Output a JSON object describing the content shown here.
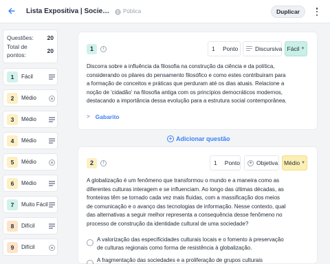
{
  "header": {
    "back_icon": "arrow-left-icon",
    "title": "Lista Expositiva | Sociedade e Política",
    "visibility": "Pública",
    "visibility_icon": "globe-icon",
    "duplicate_label": "Duplicar",
    "more_icon": "more-vertical-icon"
  },
  "sidebar": {
    "questions_label": "Questões:",
    "questions_value": "20",
    "points_label": "Total de pontos:",
    "points_value": "20",
    "items": [
      {
        "num": "1",
        "level": "Fácil",
        "type_icon": "lines-icon",
        "color": "#d1f2ea"
      },
      {
        "num": "2",
        "level": "Médio",
        "type_icon": "radio-icon",
        "color": "#fcefc2"
      },
      {
        "num": "3",
        "level": "Médio",
        "type_icon": "lines-icon",
        "color": "#fcefc2"
      },
      {
        "num": "4",
        "level": "Médio",
        "type_icon": "lines-icon",
        "color": "#fcefc2"
      },
      {
        "num": "5",
        "level": "Médio",
        "type_icon": "radio-icon",
        "color": "#fcefc2"
      },
      {
        "num": "6",
        "level": "Médio",
        "type_icon": "lines-icon",
        "color": "#fcefc2"
      },
      {
        "num": "7",
        "level": "Muito Fácil",
        "type_icon": "lines-icon",
        "color": "#d1f2ea"
      },
      {
        "num": "8",
        "level": "Difícil",
        "type_icon": "lines-icon",
        "color": "#fde3c8"
      },
      {
        "num": "9",
        "level": "Difícil",
        "type_icon": "radio-icon",
        "color": "#fde3c8"
      }
    ]
  },
  "q1": {
    "num": "1",
    "points_value": "1",
    "points_unit": "Ponto",
    "type_icon": "lines-icon",
    "type_label": "Discursiva",
    "level": "Fácil",
    "level_color": "#c9efe6",
    "text": "Discorra sobre a influência da filosofia na construção da ciência e da política, considerando os pilares do pensamento filosófico e como estes contribuiram para a formação de conceitos e práticas que perduram até os dias atuais. Relacione a noção de 'cidadão' na filosofia antiga com os princípios democráticos modernos, destacando a importância dessa evolução para a estrutura social contemporânea.",
    "answer_label": "Gabarito",
    "answer_icon": "chevron-right-icon"
  },
  "add_question": {
    "label": "Adicionar questão",
    "icon": "plus-circle-icon"
  },
  "q2": {
    "num": "2",
    "points_value": "1",
    "points_unit": "Ponto",
    "type_icon": "radio-icon",
    "type_label": "Objetiva",
    "level": "Médio",
    "level_color": "#fcefb4",
    "text": "A globalização é um fenômeno que transformou o mundo e a maneira como as diferentes culturas interagem e se influenciam. Ao longo das últimas décadas, as fronteiras têm se tornado cada vez mais fluidas, com a massificação dos meios de comunicação e o avanço das tecnologias de informação. Nesse contexto, qual das alternativas a seguir melhor representa a consequência desse fenômeno no processo de construção da identidade cultural de uma sociedade?",
    "options": [
      "A valorização das especificidades culturais locais e o fomento à preservação de culturas regionais como forma de resistência à globalização.",
      "A fragmentação das sociedades e a proliferação de grupos culturais"
    ]
  }
}
